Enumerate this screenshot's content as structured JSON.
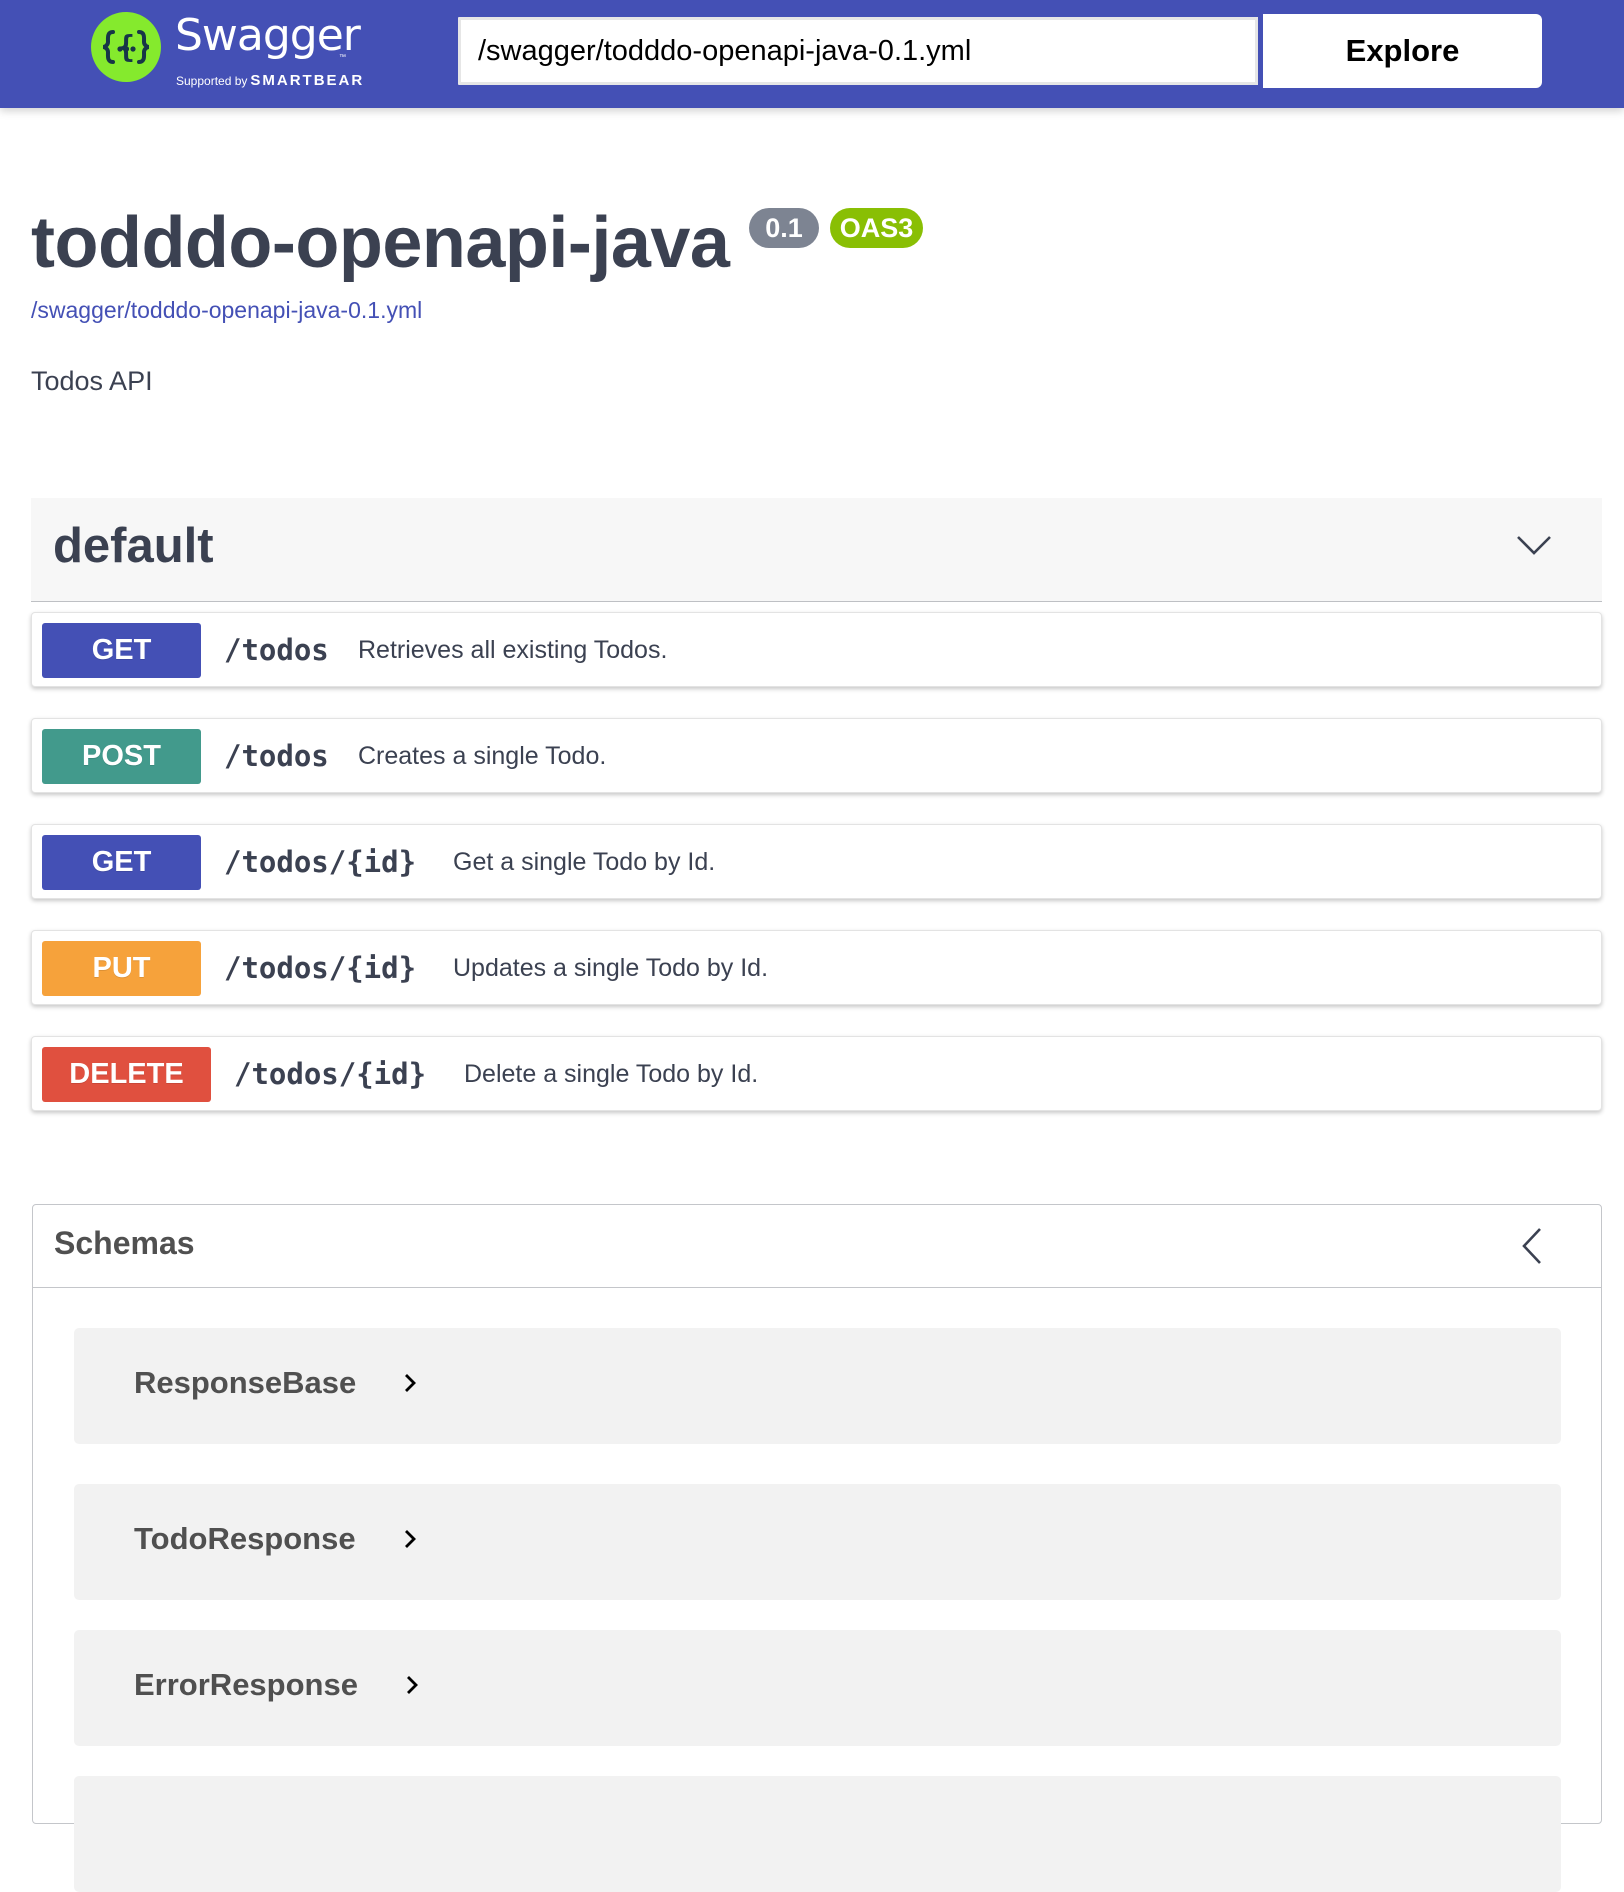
{
  "topbar": {
    "logo_text": "Swagger",
    "logo_tm": "™",
    "logo_supported": "Supported by",
    "logo_brand": "SMARTBEAR",
    "url_value": "/swagger/todddo-openapi-java-0.1.yml",
    "explore_label": "Explore",
    "background_color": "#4450b5"
  },
  "info": {
    "title": "todddo-openapi-java",
    "version_badge": "0.1",
    "oas_badge": "OAS3",
    "spec_link": "/swagger/todddo-openapi-java-0.1.yml",
    "description": "Todos API"
  },
  "tag": {
    "name": "default",
    "chevron_icon": "chevron-down-icon"
  },
  "operations": [
    {
      "method": "GET",
      "path": "/todos",
      "summary": "Retrieves all existing Todos.",
      "color": "#4450b5"
    },
    {
      "method": "POST",
      "path": "/todos",
      "summary": "Creates a single Todo.",
      "color": "#429a8c"
    },
    {
      "method": "GET",
      "path": "/todos/{id}",
      "summary": "Get a single Todo by Id.",
      "color": "#4450b5"
    },
    {
      "method": "PUT",
      "path": "/todos/{id}",
      "summary": "Updates a single Todo by Id.",
      "color": "#f6a23b"
    },
    {
      "method": "DELETE",
      "path": "/todos/{id}",
      "summary": "Delete a single Todo by Id.",
      "color": "#e0503f"
    }
  ],
  "schemas": {
    "title": "Schemas",
    "chevron_icon": "chevron-left-icon",
    "models": [
      {
        "name": "ResponseBase"
      },
      {
        "name": "TodoResponse"
      },
      {
        "name": "ErrorResponse"
      }
    ]
  }
}
